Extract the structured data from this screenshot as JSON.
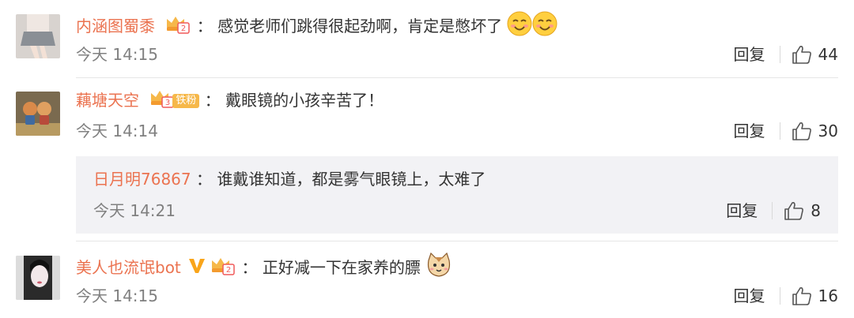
{
  "comments": [
    {
      "username": "内涵图蜀黍",
      "separator": "：",
      "text": "感觉老师们跳得很起劲啊，肯定是憋坏了",
      "emojis": [
        "smile-emoji",
        "smile-emoji"
      ],
      "time": "今天 14:15",
      "reply_label": "回复",
      "likes": "44",
      "badge_icon": "crown-level-2-icon"
    },
    {
      "username": "藕塘天空",
      "separator": "：",
      "text": "戴眼镜的小孩辛苦了！",
      "time": "今天 14:14",
      "reply_label": "回复",
      "likes": "30",
      "badge_icon": "crown-level-3-icon",
      "fan_badge": "铁粉"
    },
    {
      "username": "美人也流氓bot",
      "separator": "：",
      "text": "正好减一下在家养的膘",
      "emojis": [
        "cat-emoji"
      ],
      "time": "今天 14:15",
      "reply_label": "回复",
      "likes": "16",
      "badge_icon": "crown-level-2-icon",
      "verified_icon": "verified-v-icon"
    }
  ],
  "reply": {
    "username": "日月明76867",
    "separator": "：",
    "text": "谁戴谁知道，都是雾气眼镜上，太难了",
    "time": "今天 14:21",
    "reply_label": "回复",
    "likes": "8"
  },
  "colors": {
    "username": "#eb7350",
    "reply_bg": "#f2f2f5",
    "meta": "#808080"
  }
}
